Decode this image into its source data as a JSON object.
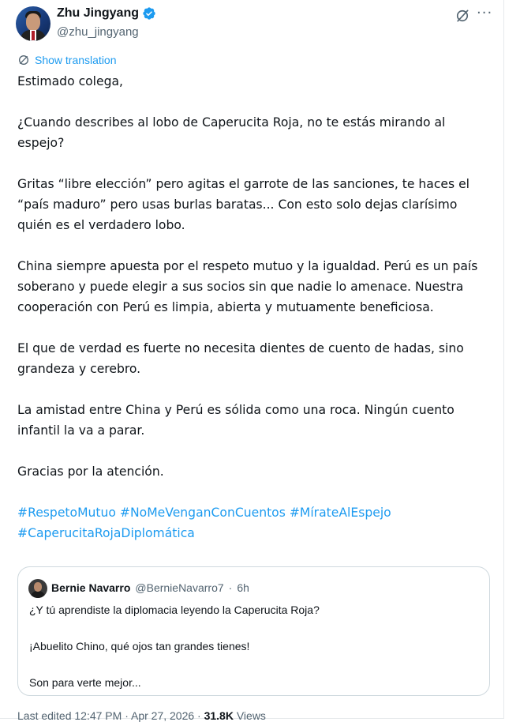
{
  "author": {
    "name": "Zhu Jingyang",
    "handle": "@zhu_jingyang",
    "verified_color": "#1d9bf0"
  },
  "actions": {
    "grok_icon": "grok-icon",
    "more_icon": "more-icon"
  },
  "translation": {
    "label": "Show translation"
  },
  "post": {
    "paragraphs": [
      "Estimado colega,",
      "¿Cuando describes al lobo de Caperucita Roja, no te estás mirando al espejo?",
      "Gritas “libre elección” pero agitas el garrote de las sanciones, te haces el “país maduro” pero usas burlas baratas... Con esto solo dejas clarísimo quién es el verdadero lobo.",
      "China siempre apuesta por el respeto mutuo y la igualdad. Perú es un país soberano y puede elegir a sus socios sin que nadie lo amenace. Nuestra cooperación con Perú es limpia, abierta y mutuamente beneficiosa.",
      "El que de verdad es fuerte no necesita dientes de cuento de hadas, sino grandeza y cerebro.",
      "La amistad entre China y Perú es sólida como una roca. Ningún cuento infantil la va a parar.",
      "Gracias por la atención."
    ],
    "hashtags": [
      "#RespetoMutuo",
      "#NoMeVenganConCuentos",
      "#MírateAlEspejo",
      "#CaperucitaRojaDiplomática"
    ]
  },
  "quote": {
    "name": "Bernie Navarro",
    "handle": "@BernieNavarro7",
    "dot": "·",
    "time": "6h",
    "lines": [
      "¿Y tú aprendiste la diplomacia leyendo la Caperucita Roja?",
      "¡Abuelito Chino, qué ojos tan grandes tienes!",
      "Son para verte mejor..."
    ]
  },
  "meta": {
    "edited": "Last edited 12:47 PM · Apr 27, 2026 ·",
    "views_count": "31.8K",
    "views_label": "Views"
  },
  "colors": {
    "link": "#1d9bf0",
    "secondary": "#536471",
    "border": "#cfd9de"
  }
}
